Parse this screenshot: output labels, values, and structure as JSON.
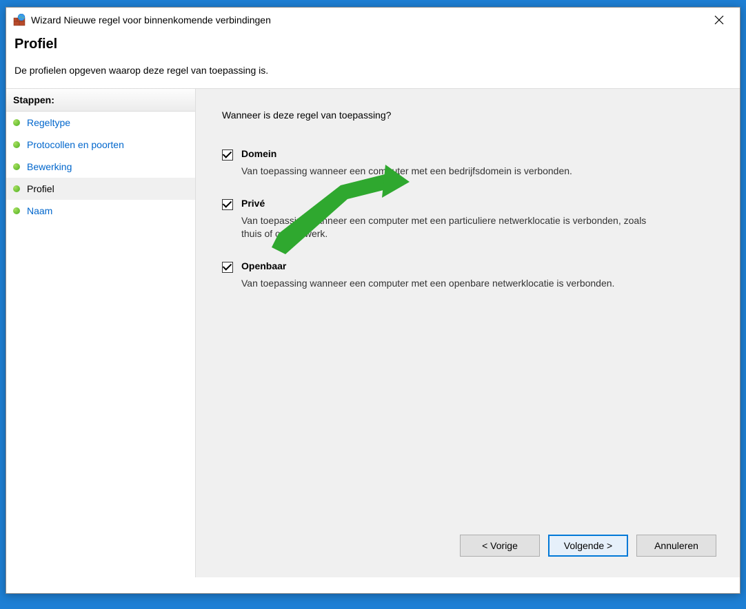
{
  "titlebar": {
    "text": "Wizard Nieuwe regel voor binnenkomende verbindingen"
  },
  "header": {
    "title": "Profiel",
    "subtitle": "De profielen opgeven waarop deze regel van toepassing is."
  },
  "sidebar": {
    "steps_header": "Stappen:",
    "steps": [
      {
        "label": "Regeltype",
        "current": false
      },
      {
        "label": "Protocollen en poorten",
        "current": false
      },
      {
        "label": "Bewerking",
        "current": false
      },
      {
        "label": "Profiel",
        "current": true
      },
      {
        "label": "Naam",
        "current": false
      }
    ]
  },
  "content": {
    "question": "Wanneer is deze regel van toepassing?",
    "options": [
      {
        "label": "Domein",
        "checked": true,
        "description": "Van toepassing wanneer een computer met een bedrijfsdomein is verbonden."
      },
      {
        "label": "Privé",
        "checked": true,
        "description": "Van toepassing wanneer een computer met een particuliere netwerklocatie is verbonden, zoals thuis of op het werk."
      },
      {
        "label": "Openbaar",
        "checked": true,
        "description": "Van toepassing wanneer een computer met een openbare netwerklocatie is verbonden."
      }
    ]
  },
  "buttons": {
    "back": "< Vorige",
    "next": "Volgende >",
    "cancel": "Annuleren"
  }
}
